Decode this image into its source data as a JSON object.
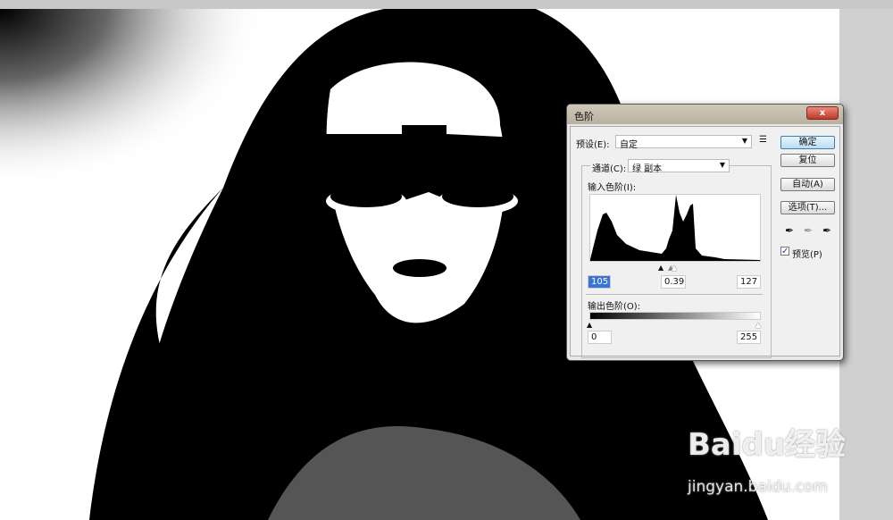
{
  "dialog": {
    "title": "色阶",
    "close": "x",
    "preset_label": "预设(E):",
    "preset_value": "自定",
    "channel_label": "通道(C):",
    "channel_value": "绿 副本",
    "input_label": "输入色阶(I):",
    "input_black": "105",
    "input_gamma": "0.39",
    "input_white": "127",
    "output_label": "输出色阶(O):",
    "output_black": "0",
    "output_white": "255",
    "buttons": {
      "ok": "确定",
      "reset": "复位",
      "auto": "自动(A)",
      "options": "选项(T)..."
    },
    "preview_label": "预览(P)",
    "preview_checked": true
  },
  "watermark": {
    "logo": "Baidu经验",
    "url": "jingyan.baidu.com"
  }
}
